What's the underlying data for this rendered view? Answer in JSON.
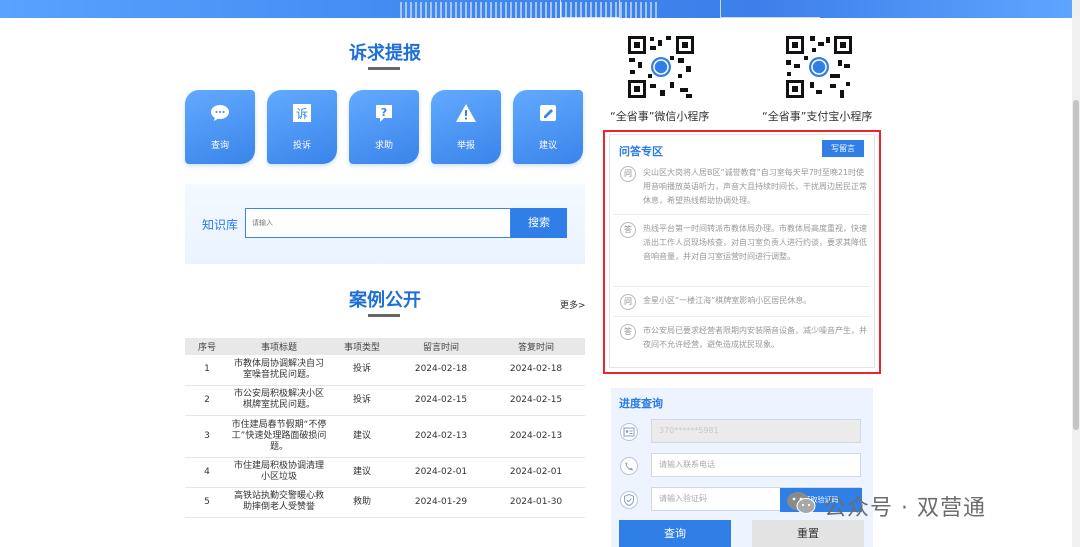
{
  "colors": {
    "accent": "#2f7fe6",
    "highlight_border": "#e8262b",
    "title_blue": "#1f6fd6"
  },
  "petition": {
    "title": "诉求提报",
    "tiles": [
      {
        "label": "查询",
        "icon": "chat-bubble-icon"
      },
      {
        "label": "投诉",
        "icon": "complaint-su-icon"
      },
      {
        "label": "求助",
        "icon": "help-question-icon"
      },
      {
        "label": "举报",
        "icon": "warning-triangle-icon"
      },
      {
        "label": "建议",
        "icon": "edit-suggest-icon"
      }
    ]
  },
  "knowledge": {
    "label": "知识库",
    "placeholder": "请输入",
    "search_button": "搜索"
  },
  "cases": {
    "title": "案例公开",
    "more": "更多>",
    "columns": [
      "序号",
      "事项标题",
      "事项类型",
      "留言时间",
      "答复时间"
    ],
    "rows": [
      {
        "no": "1",
        "title": "市教体局协调解决自习室噪音扰民问题。",
        "type": "投诉",
        "posted": "2024-02-18",
        "replied": "2024-02-18"
      },
      {
        "no": "2",
        "title": "市公安局积极解决小区棋牌室扰民问题。",
        "type": "投诉",
        "posted": "2024-02-15",
        "replied": "2024-02-15"
      },
      {
        "no": "3",
        "title": "市住建局春节假期“不停工”快速处理路面破损问题。",
        "type": "建议",
        "posted": "2024-02-13",
        "replied": "2024-02-13"
      },
      {
        "no": "4",
        "title": "市住建局积极协调清理小区垃圾",
        "type": "建议",
        "posted": "2024-02-01",
        "replied": "2024-02-01"
      },
      {
        "no": "5",
        "title": "高铁站执勤交警暖心救助摔倒老人受赞誉",
        "type": "救助",
        "posted": "2024-01-29",
        "replied": "2024-01-30"
      }
    ]
  },
  "qr": {
    "wechat_caption": "“全省事”微信小程序",
    "alipay_caption": "“全省事”支付宝小程序"
  },
  "qa": {
    "title": "问答专区",
    "write_button": "写留言",
    "items": [
      {
        "badge": "问",
        "text": "尖山区大岗将人居B区“诚誉教育”自习室每天早7时至晚21时使用音响播放英语听力，声音大且持续时间长，干扰周边居民正常休息，希望热线帮助协调处理。"
      },
      {
        "badge": "答",
        "text": "热线平台第一时间转派市教体局办理。市教体局高度重视，快速派出工作人员现场核查，对自习室负责人进行约谈，要求其降低音响音量，并对自习室运营时间进行调整。"
      },
      {
        "badge": "问",
        "text": "金星小区“一楼江海”棋牌室影响小区居民休息。"
      },
      {
        "badge": "答",
        "text": "市公安局已要求经营者限期内安装隔音设备，减少噪音产生，并夜间不允许经营，避免造成扰民现象。"
      }
    ]
  },
  "progress": {
    "title": "进度查询",
    "id_placeholder": "370******5981",
    "phone_placeholder": "请输入联系电话",
    "captcha_placeholder": "请输入验证码",
    "captcha_button": "获取验证码",
    "query_button": "查询",
    "reset_button": "重置"
  },
  "watermark": {
    "text": "公众号 · 双营通"
  }
}
